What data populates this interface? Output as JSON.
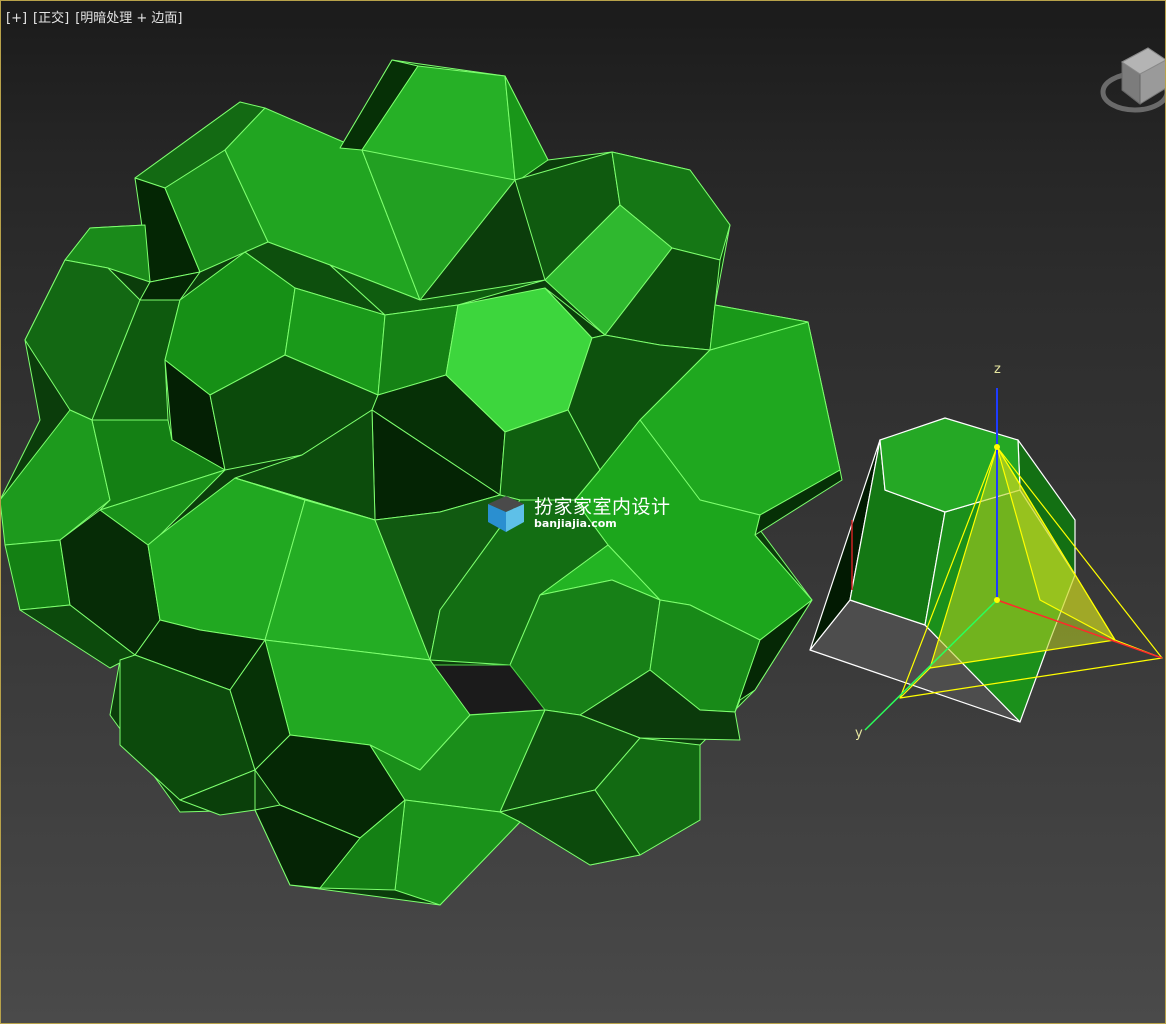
{
  "viewport": {
    "label_parts": [
      "[+]",
      "[正交]",
      "[明暗处理 + 边面]"
    ]
  },
  "gizmo": {
    "axis_z": "z",
    "axis_y": "y"
  },
  "watermark": {
    "title": "扮家家室内设计",
    "url": "banjiajia.com"
  },
  "colors": {
    "border": "#b8a24a",
    "edge": "#7dff6e",
    "selection": "#ffff00",
    "axis_z": "#1e3cff",
    "axis_x": "#ff2a2a",
    "axis_y": "#2aff5a"
  }
}
